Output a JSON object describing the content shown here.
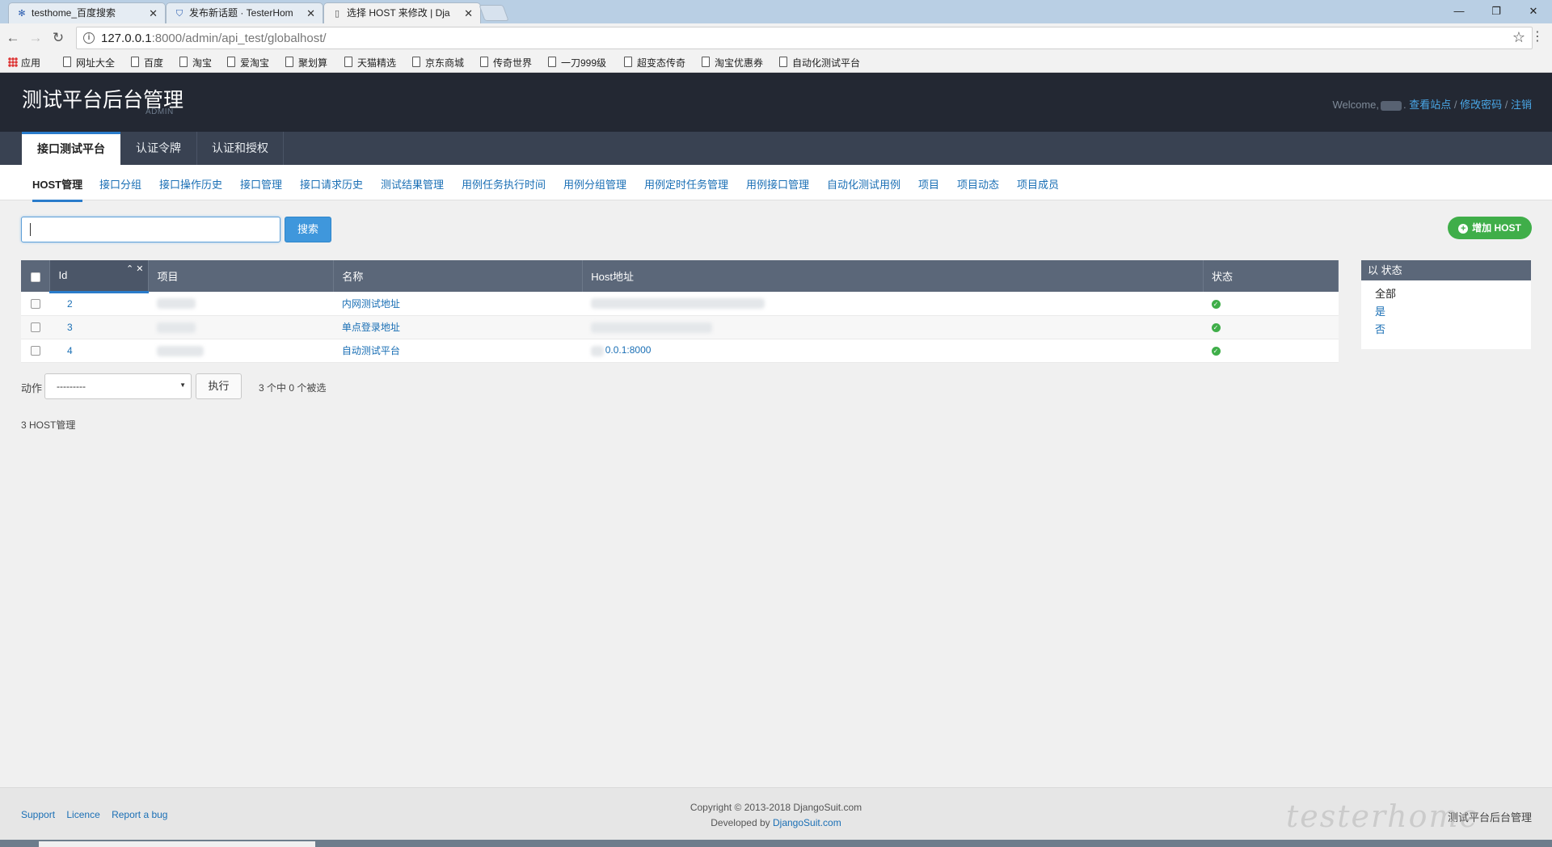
{
  "browser": {
    "tabs": [
      {
        "title": "testhome_百度搜索",
        "icon": "baidu-paw-icon"
      },
      {
        "title": "发布新话题 · TesterHom",
        "icon": "testerhome-shield-icon"
      },
      {
        "title": "选择 HOST 来修改 | Dja",
        "icon": "page-icon"
      }
    ],
    "url_host": "127.0.0.1",
    "url_path": ":8000/admin/api_test/globalhost/",
    "bookmarks": [
      "应用",
      "网址大全",
      "百度",
      "淘宝",
      "爱淘宝",
      "聚划算",
      "天猫精选",
      "京东商城",
      "传奇世界",
      "一刀999级",
      "超变态传奇",
      "淘宝优惠券",
      "自动化测试平台"
    ]
  },
  "header": {
    "title": "测试平台后台管理",
    "subtitle": "ADMIN",
    "welcome": "Welcome,",
    "view_site": "查看站点",
    "change_password": "修改密码",
    "logout": "注销"
  },
  "primary_nav": [
    "接口测试平台",
    "认证令牌",
    "认证和授权"
  ],
  "secondary_nav": [
    "HOST管理",
    "接口分组",
    "接口操作历史",
    "接口管理",
    "接口请求历史",
    "测试结果管理",
    "用例任务执行时间",
    "用例分组管理",
    "用例定时任务管理",
    "用例接口管理",
    "自动化测试用例",
    "项目",
    "项目动态",
    "项目成员"
  ],
  "search": {
    "button": "搜索"
  },
  "add_button": "增加 HOST",
  "table": {
    "headers": [
      "Id",
      "项目",
      "名称",
      "Host地址",
      "状态"
    ],
    "rows": [
      {
        "id": "2",
        "name": "内网测试地址",
        "host": ""
      },
      {
        "id": "3",
        "name": "单点登录地址",
        "host": ""
      },
      {
        "id": "4",
        "name": "自动测试平台",
        "host": "0.0.1:8000"
      }
    ]
  },
  "filter": {
    "title": "以 状态",
    "options": [
      "全部",
      "是",
      "否"
    ]
  },
  "actions": {
    "label": "动作",
    "selected": "---------",
    "go": "执行",
    "counter": "3 个中 0 个被选"
  },
  "paginator": "3 HOST管理",
  "footer": {
    "links": [
      "Support",
      "Licence",
      "Report a bug"
    ],
    "copyright": "Copyright © 2013-2018 DjangoSuit.com",
    "developed_by": "Developed by",
    "developer": "DjangoSuit.com",
    "brand": "测试平台后台管理",
    "watermark": "testerhome"
  }
}
